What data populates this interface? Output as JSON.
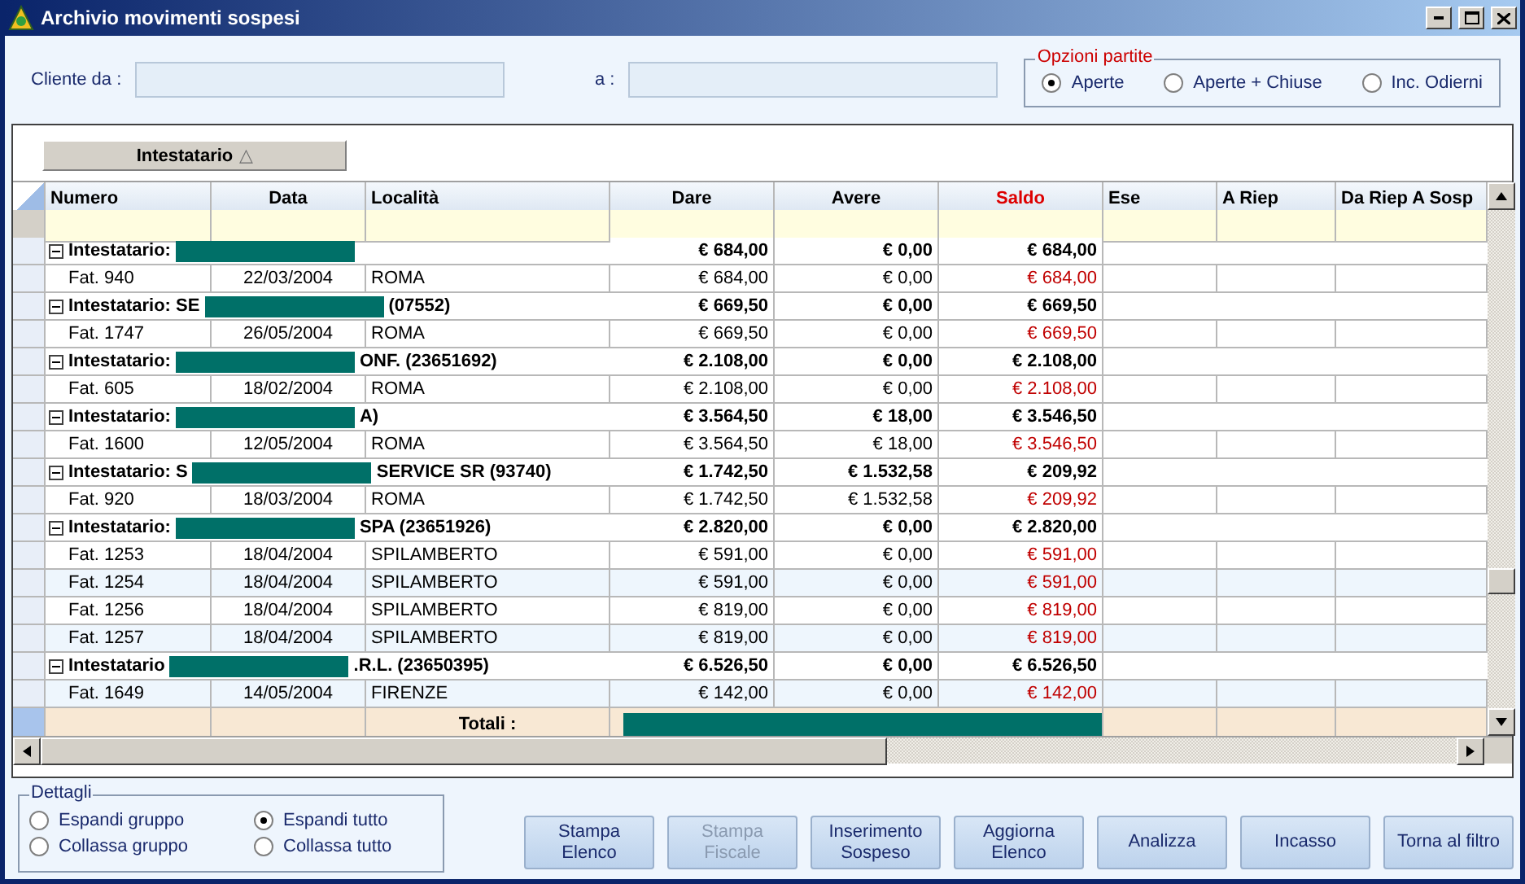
{
  "window": {
    "title": "Archivio movimenti sospesi"
  },
  "filter": {
    "from_label": "Cliente  da :",
    "to_label": "a :"
  },
  "options": {
    "title": "Opzioni partite",
    "items": [
      {
        "label": "Aperte",
        "selected": true
      },
      {
        "label": "Aperte + Chiuse",
        "selected": false
      },
      {
        "label": "Inc. Odierni",
        "selected": false
      }
    ]
  },
  "group_by": {
    "label": "Intestatario",
    "sort_glyph": "△"
  },
  "table": {
    "columns": [
      {
        "label": "Numero"
      },
      {
        "label": "Data"
      },
      {
        "label": "Località"
      },
      {
        "label": "Dare"
      },
      {
        "label": "Avere"
      },
      {
        "label": "Saldo",
        "color": "#dd0000"
      },
      {
        "label": "Ese"
      },
      {
        "label": "A Riep"
      },
      {
        "label": "Da Riep A Sosp"
      }
    ],
    "rows": [
      {
        "kind": "group",
        "label": [
          {
            "kind": "text",
            "text": "Intestatario:"
          },
          {
            "kind": "redacted"
          }
        ],
        "dare": "€ 684,00",
        "avere": "€ 0,00",
        "saldo": "€ 684,00"
      },
      {
        "kind": "item",
        "shaded": false,
        "numero": "Fat. 940",
        "data": "22/03/2004",
        "localita": "ROMA",
        "dare": "€ 684,00",
        "avere": "€ 0,00",
        "saldo": "€ 684,00"
      },
      {
        "kind": "group",
        "label": [
          {
            "kind": "text",
            "text": "Intestatario: SE"
          },
          {
            "kind": "redacted"
          },
          {
            "kind": "text",
            "text": "(07552)"
          }
        ],
        "dare": "€ 669,50",
        "avere": "€ 0,00",
        "saldo": "€ 669,50"
      },
      {
        "kind": "item",
        "shaded": false,
        "numero": "Fat. 1747",
        "data": "26/05/2004",
        "localita": "ROMA",
        "dare": "€ 669,50",
        "avere": "€ 0,00",
        "saldo": "€ 669,50"
      },
      {
        "kind": "group",
        "label": [
          {
            "kind": "text",
            "text": "Intestatario:"
          },
          {
            "kind": "redacted"
          },
          {
            "kind": "text",
            "text": "ONF. (23651692)"
          }
        ],
        "dare": "€ 2.108,00",
        "avere": "€ 0,00",
        "saldo": "€ 2.108,00"
      },
      {
        "kind": "item",
        "shaded": false,
        "numero": "Fat. 605",
        "data": "18/02/2004",
        "localita": "ROMA",
        "dare": "€ 2.108,00",
        "avere": "€ 0,00",
        "saldo": "€ 2.108,00"
      },
      {
        "kind": "group",
        "label": [
          {
            "kind": "text",
            "text": "Intestatario:"
          },
          {
            "kind": "redacted"
          },
          {
            "kind": "text",
            "text": "A)"
          }
        ],
        "dare": "€ 3.564,50",
        "avere": "€ 18,00",
        "saldo": "€ 3.546,50"
      },
      {
        "kind": "item",
        "shaded": false,
        "numero": "Fat. 1600",
        "data": "12/05/2004",
        "localita": "ROMA",
        "dare": "€ 3.564,50",
        "avere": "€ 18,00",
        "saldo": "€ 3.546,50"
      },
      {
        "kind": "group",
        "label": [
          {
            "kind": "text",
            "text": "Intestatario: S"
          },
          {
            "kind": "redacted"
          },
          {
            "kind": "text",
            "text": "SERVICE SR (93740)"
          }
        ],
        "dare": "€ 1.742,50",
        "avere": "€ 1.532,58",
        "saldo": "€ 209,92"
      },
      {
        "kind": "item",
        "shaded": false,
        "numero": "Fat. 920",
        "data": "18/03/2004",
        "localita": "ROMA",
        "dare": "€ 1.742,50",
        "avere": "€ 1.532,58",
        "saldo": "€ 209,92"
      },
      {
        "kind": "group",
        "label": [
          {
            "kind": "text",
            "text": "Intestatario:"
          },
          {
            "kind": "redacted"
          },
          {
            "kind": "text",
            "text": "SPA (23651926)"
          }
        ],
        "dare": "€ 2.820,00",
        "avere": "€ 0,00",
        "saldo": "€ 2.820,00"
      },
      {
        "kind": "item",
        "shaded": false,
        "numero": "Fat. 1253",
        "data": "18/04/2004",
        "localita": "SPILAMBERTO",
        "dare": "€ 591,00",
        "avere": "€ 0,00",
        "saldo": "€ 591,00"
      },
      {
        "kind": "item",
        "shaded": true,
        "numero": "Fat. 1254",
        "data": "18/04/2004",
        "localita": "SPILAMBERTO",
        "dare": "€ 591,00",
        "avere": "€ 0,00",
        "saldo": "€ 591,00"
      },
      {
        "kind": "item",
        "shaded": false,
        "numero": "Fat. 1256",
        "data": "18/04/2004",
        "localita": "SPILAMBERTO",
        "dare": "€ 819,00",
        "avere": "€ 0,00",
        "saldo": "€ 819,00"
      },
      {
        "kind": "item",
        "shaded": true,
        "numero": "Fat. 1257",
        "data": "18/04/2004",
        "localita": "SPILAMBERTO",
        "dare": "€ 819,00",
        "avere": "€ 0,00",
        "saldo": "€ 819,00"
      },
      {
        "kind": "group",
        "label": [
          {
            "kind": "text",
            "text": "Intestatario"
          },
          {
            "kind": "redacted"
          },
          {
            "kind": "text",
            "text": ".R.L. (23650395)"
          }
        ],
        "dare": "€ 6.526,50",
        "avere": "€ 0,00",
        "saldo": "€ 6.526,50"
      },
      {
        "kind": "item",
        "shaded": true,
        "numero": "Fat. 1649",
        "data": "14/05/2004",
        "localita": "FIRENZE",
        "dare": "€ 142,00",
        "avere": "€ 0,00",
        "saldo": "€ 142,00"
      }
    ],
    "totals": {
      "label": "Totali :"
    }
  },
  "details": {
    "title": "Dettagli",
    "items": [
      {
        "label": "Espandi gruppo",
        "selected": false
      },
      {
        "label": "Espandi tutto",
        "selected": true
      },
      {
        "label": "Collassa gruppo",
        "selected": false
      },
      {
        "label": "Collassa tutto",
        "selected": false
      }
    ]
  },
  "buttons": [
    {
      "label": "Stampa Elenco",
      "disabled": false
    },
    {
      "label": "Stampa Fiscale",
      "disabled": true
    },
    {
      "label": "Inserimento Sospeso",
      "disabled": false
    },
    {
      "label": "Aggiorna Elenco",
      "disabled": false
    },
    {
      "label": "Analizza",
      "disabled": false
    },
    {
      "label": "Incasso",
      "disabled": false
    },
    {
      "label": "Torna al filtro",
      "disabled": false
    }
  ]
}
